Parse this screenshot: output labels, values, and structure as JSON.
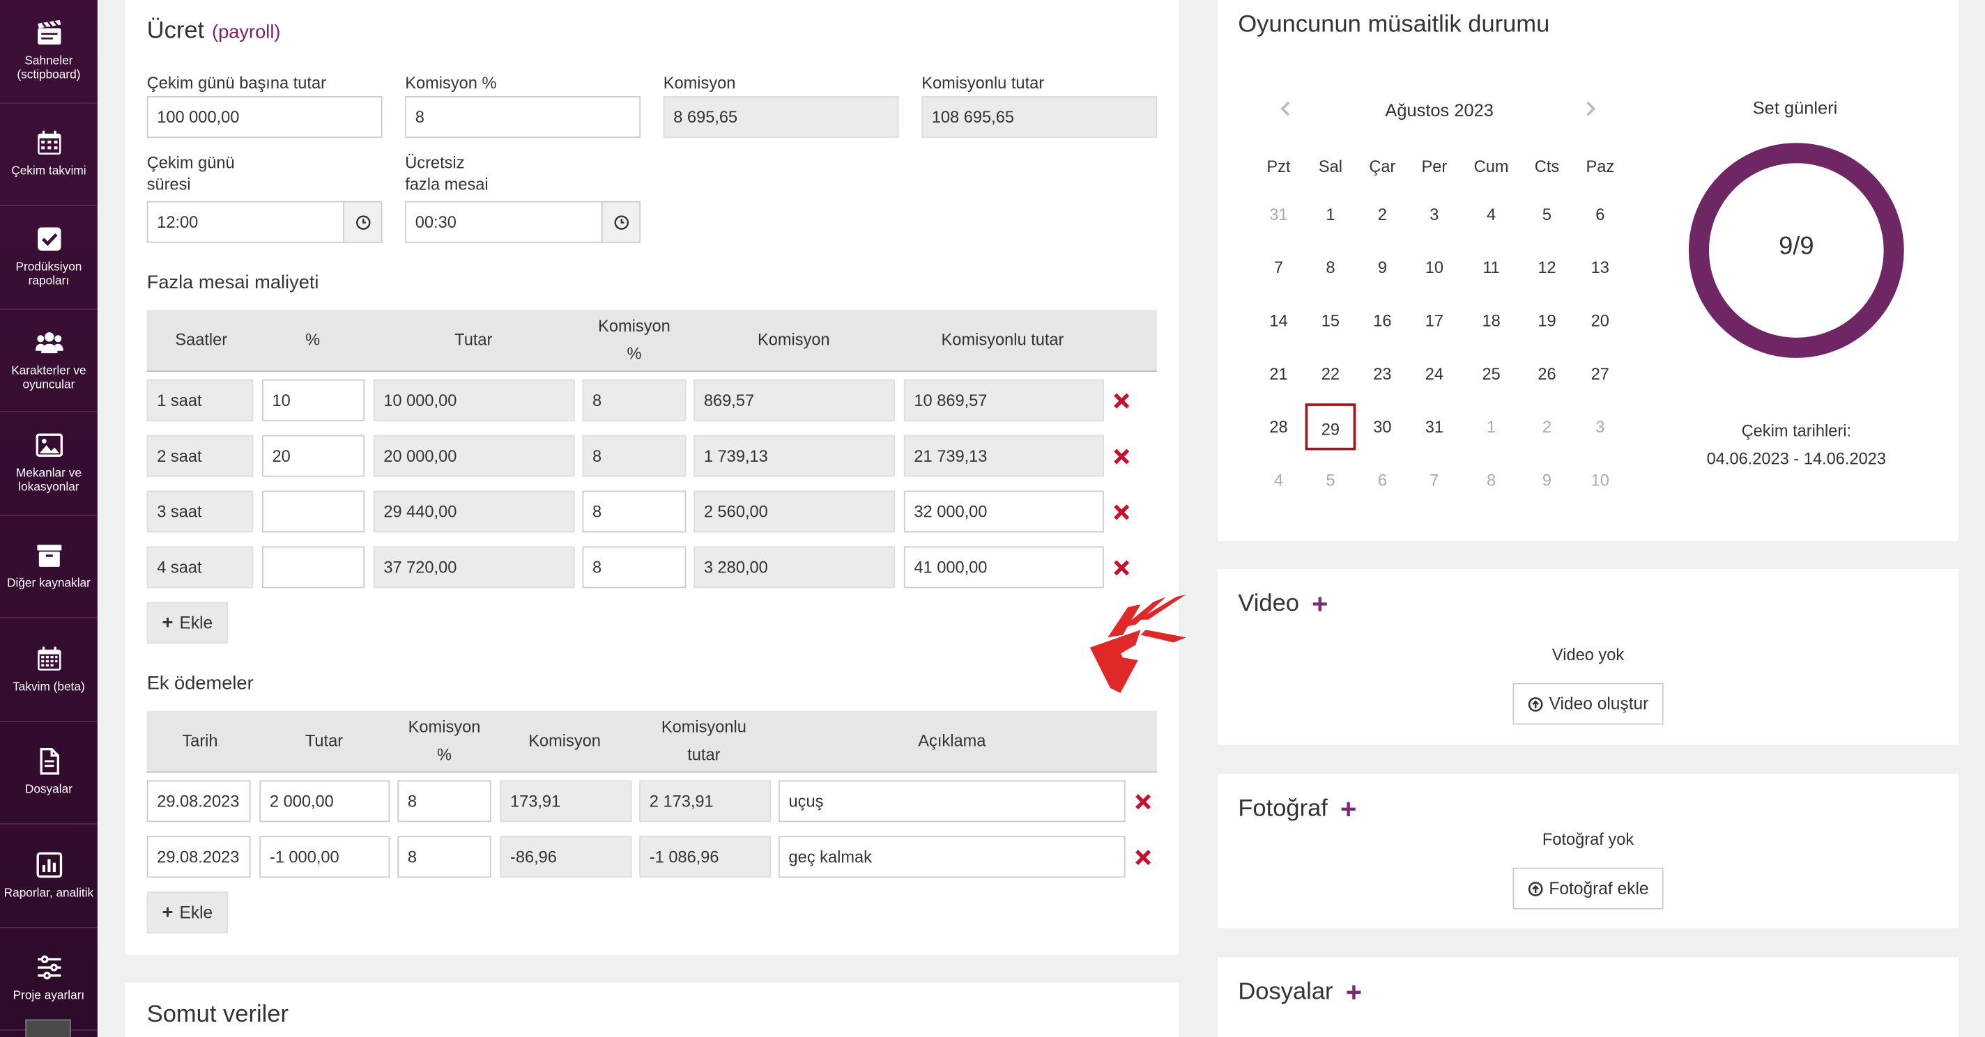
{
  "sidebar": {
    "items": [
      {
        "label": "Sahneler (sctipboard)",
        "icon": "clapperboard-icon"
      },
      {
        "label": "Çekim takvimi",
        "icon": "calendar-icon"
      },
      {
        "label": "Prodüksiyon rapoları",
        "icon": "checkbox-icon"
      },
      {
        "label": "Karakterler ve oyuncular",
        "icon": "users-icon"
      },
      {
        "label": "Mekanlar ve lokasyonlar",
        "icon": "image-icon"
      },
      {
        "label": "Diğer kaynaklar",
        "icon": "box-icon"
      },
      {
        "label": "Takvim (beta)",
        "icon": "calendar-grid-icon"
      },
      {
        "label": "Dosyalar",
        "icon": "document-icon"
      },
      {
        "label": "Raporlar, analitik",
        "icon": "chart-icon"
      },
      {
        "label": "Proje ayarları",
        "icon": "sliders-icon"
      }
    ]
  },
  "fee": {
    "title": "Ücret",
    "subtitle": "(payroll)",
    "per_day_label": "Çekim günü başına tutar",
    "per_day_value": "100 000,00",
    "commission_pct_label": "Komisyon %",
    "commission_pct_value": "8",
    "commission_label": "Komisyon",
    "commission_value": "8 695,65",
    "total_label": "Komisyonlu tutar",
    "total_value": "108 695,65",
    "duration_label_1": "Çekim günü",
    "duration_label_2": "süresi",
    "duration_value": "12:00",
    "free_ot_label_1": "Ücretsiz",
    "free_ot_label_2": "fazla mesai",
    "free_ot_value": "00:30"
  },
  "overtime": {
    "title": "Fazla mesai maliyeti",
    "headers": {
      "hours": "Saatler",
      "pct": "%",
      "amount": "Tutar",
      "comm_pct_1": "Komisyon",
      "comm_pct_2": "%",
      "comm": "Komisyon",
      "total": "Komisyonlu tutar"
    },
    "rows": [
      {
        "hours": "1 saat",
        "pct": "10",
        "amount": "10 000,00",
        "comm_pct": "8",
        "comm": "869,57",
        "total": "10 869,57"
      },
      {
        "hours": "2 saat",
        "pct": "20",
        "amount": "20 000,00",
        "comm_pct": "8",
        "comm": "1 739,13",
        "total": "21 739,13"
      },
      {
        "hours": "3 saat",
        "pct": "",
        "amount": "29 440,00",
        "comm_pct": "8",
        "comm": "2 560,00",
        "total": "32 000,00"
      },
      {
        "hours": "4 saat",
        "pct": "",
        "amount": "37 720,00",
        "comm_pct": "8",
        "comm": "3 280,00",
        "total": "41 000,00"
      }
    ],
    "add_label": "Ekle"
  },
  "extra": {
    "title": "Ek ödemeler",
    "headers": {
      "date": "Tarih",
      "amount": "Tutar",
      "comm_pct_1": "Komisyon",
      "comm_pct_2": "%",
      "comm": "Komisyon",
      "total_1": "Komisyonlu",
      "total_2": "tutar",
      "desc": "Açıklama"
    },
    "rows": [
      {
        "date": "29.08.2023",
        "amount": "2 000,00",
        "comm_pct": "8",
        "comm": "173,91",
        "total": "2 173,91",
        "desc": "uçuş"
      },
      {
        "date": "29.08.2023",
        "amount": "-1 000,00",
        "comm_pct": "8",
        "comm": "-86,96",
        "total": "-1 086,96",
        "desc": "geç kalmak"
      }
    ],
    "add_label": "Ekle"
  },
  "concrete": {
    "title": "Somut veriler"
  },
  "availability": {
    "title": "Oyuncunun müsaitlik durumu",
    "month": "Ağustos 2023",
    "weekdays": [
      "Pzt",
      "Sal",
      "Çar",
      "Per",
      "Cum",
      "Cts",
      "Paz"
    ],
    "weeks": [
      [
        "31",
        "1",
        "2",
        "3",
        "4",
        "5",
        "6"
      ],
      [
        "7",
        "8",
        "9",
        "10",
        "11",
        "12",
        "13"
      ],
      [
        "14",
        "15",
        "16",
        "17",
        "18",
        "19",
        "20"
      ],
      [
        "21",
        "22",
        "23",
        "24",
        "25",
        "26",
        "27"
      ],
      [
        "28",
        "29",
        "30",
        "31",
        "1",
        "2",
        "3"
      ],
      [
        "4",
        "5",
        "6",
        "7",
        "8",
        "9",
        "10"
      ]
    ],
    "selected_day": "29",
    "set_days_label": "Set günleri",
    "set_days_value": "9/9",
    "set_days_fraction": 1.0,
    "dates_label": "Çekim tarihleri:",
    "dates_value": "04.06.2023 - 14.06.2023"
  },
  "video": {
    "title": "Video",
    "empty": "Video yok",
    "button": "Video oluştur"
  },
  "photo": {
    "title": "Fotoğraf",
    "empty": "Fotoğraf yok",
    "button": "Fotoğraf ekle"
  },
  "files": {
    "title": "Dosyalar"
  },
  "colors": {
    "brand": "#7a2a73",
    "delete": "#c8102e",
    "arrow": "#e02828"
  }
}
